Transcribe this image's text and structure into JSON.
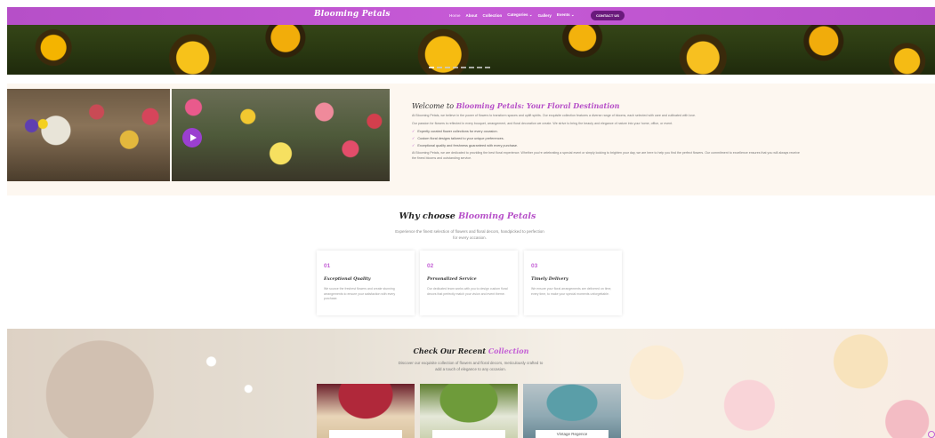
{
  "header": {
    "logo": "Blooming Petals",
    "menu": [
      "Home",
      "About",
      "Collection",
      "Categories ⌄",
      "Gallery",
      "Events ⌄"
    ],
    "contact_label": "CONTACT US",
    "slider_dots": 8
  },
  "welcome": {
    "title_prefix": "Welcome to ",
    "title_main": "Blooming Petals: Your Floral Destination",
    "p1": "At Blooming Petals, we believe in the power of flowers to transform spaces and uplift spirits. Our exquisite collection features a diverse range of blooms, each selected with care and cultivated with love.",
    "p2": "Our passion for flowers is reflected in every bouquet, arrangement, and floral decoration we create. We strive to bring the beauty and elegance of nature into your home, office, or event.",
    "checks": [
      "Expertly curated flower collections for every occasion.",
      "Custom floral designs tailored to your unique preferences.",
      "Exceptional quality and freshness guaranteed with every purchase."
    ],
    "p3": "At Blooming Petals, we are dedicated to providing the best floral experience. Whether you're celebrating a special event or simply looking to brighten your day, we are here to help you find the perfect flowers. Our commitment to excellence ensures that you will always receive the finest blooms and outstanding service."
  },
  "why": {
    "title_prefix": "Why choose ",
    "title_accent": "Blooming Petals",
    "subtitle": "Experience the finest selection of flowers and floral decors, handpicked to perfection for every occasion.",
    "cards": [
      {
        "num": "01",
        "title": "Exceptional Quality",
        "desc": "We source the freshest flowers and create stunning arrangements to ensure your satisfaction with every purchase."
      },
      {
        "num": "02",
        "title": "Personalized Service",
        "desc": "Our dedicated team works with you to design custom floral decors that perfectly match your vision and event theme."
      },
      {
        "num": "03",
        "title": "Timely Delivery",
        "desc": "We ensure your floral arrangements are delivered on time, every time, to make your special moments unforgettable."
      }
    ]
  },
  "collection": {
    "title_prefix": "Check Our Recent ",
    "title_accent": "Collection",
    "subtitle": "Discover our exquisite collection of flowers and floral decors, meticulously crafted to add a touch of elegance to any occasion.",
    "tiles": [
      "",
      "",
      "Vintage Regence"
    ]
  }
}
